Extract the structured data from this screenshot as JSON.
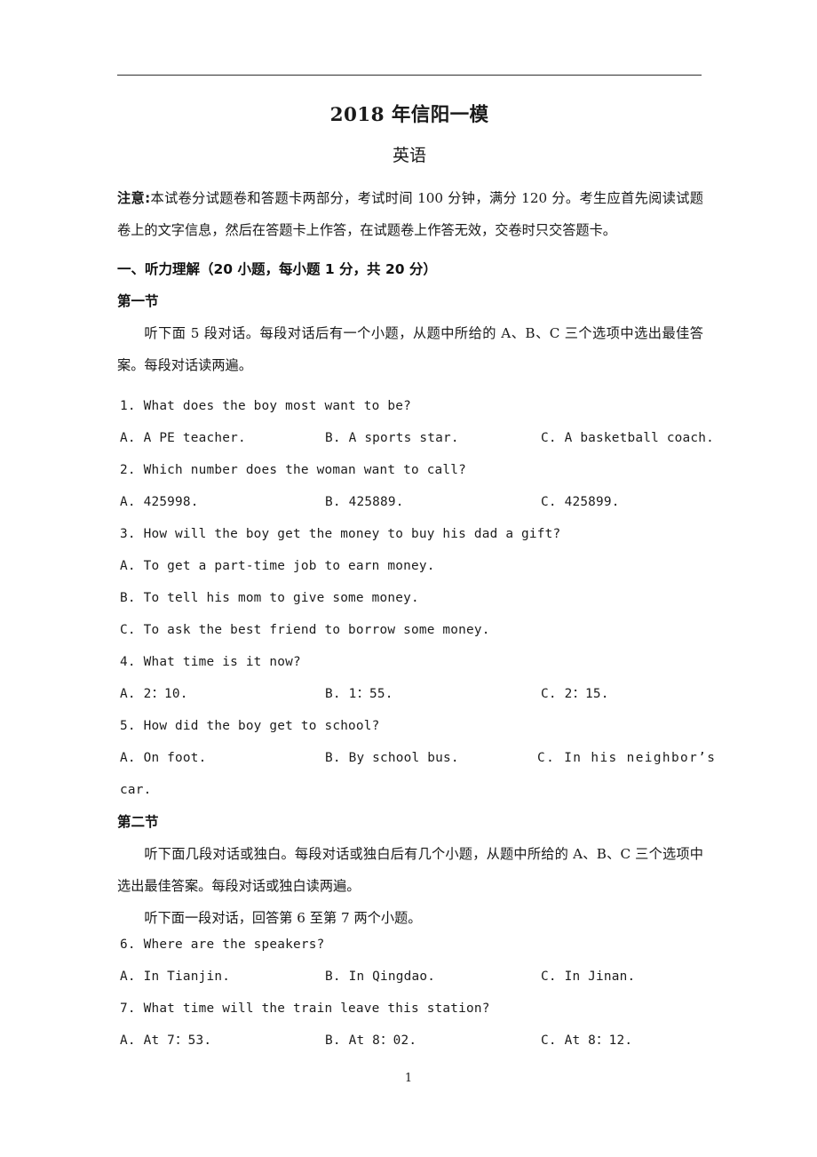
{
  "document": {
    "title": "2018 年信阳一模",
    "subtitle": "英语",
    "page_number": "1"
  },
  "notice": {
    "label": "注意:",
    "text": "本试卷分试题卷和答题卡两部分，考试时间 100 分钟，满分 120 分。考生应首先阅读试题卷上的文字信息，然后在答题卡上作答，在试题卷上作答无效，交卷时只交答题卡。"
  },
  "part_one": {
    "heading": "一、听力理解（20 小题，每小题 1 分，共 20 分）",
    "section_one": {
      "heading": "第一节",
      "instruction": "听下面 5 段对话。每段对话后有一个小题，从题中所给的 A、B、C 三个选项中选出最佳答案。每段对话读两遍。"
    },
    "section_two": {
      "heading": "第二节",
      "instruction": "听下面几段对话或独白。每段对话或独白后有几个小题，从题中所给的 A、B、C 三个选项中选出最佳答案。每段对话或独白读两遍。",
      "sub_instruction": "听下面一段对话，回答第 6 至第 7 两个小题。"
    }
  },
  "questions": [
    {
      "number": "1.",
      "stem": "1. What does the boy most want to be?",
      "layout": "row",
      "options": [
        "A. A PE teacher.",
        "B. A sports star.",
        "C. A basketball coach."
      ]
    },
    {
      "number": "2.",
      "stem": "2. Which number does the woman want to call?",
      "layout": "row",
      "options": [
        "A. 425998.",
        "B. 425889.",
        "C. 425899."
      ]
    },
    {
      "number": "3.",
      "stem": "3. How will the boy get the money to buy his dad a gift?",
      "layout": "stacked",
      "options": [
        "A. To get a part-time job to earn money.",
        "B. To tell his mom to give some money.",
        "C. To ask the best friend to borrow some money."
      ]
    },
    {
      "number": "4.",
      "stem": "4. What time is it now?",
      "layout": "row",
      "options": [
        "A. 2：10.",
        "B. 1：55.",
        "C. 2：15."
      ]
    },
    {
      "number": "5.",
      "stem": "5. How did the boy get to school?",
      "layout": "row-wrapped",
      "options": [
        "A. On foot.",
        "B. By school bus.",
        "C. In his neighbor’s"
      ],
      "wrapped_tail": "car."
    },
    {
      "number": "6.",
      "stem": "6. Where are the speakers?",
      "layout": "row",
      "options": [
        "A. In Tianjin.",
        "B. In Qingdao.",
        "C. In Jinan."
      ]
    },
    {
      "number": "7.",
      "stem": "7. What time will the train leave this station?",
      "layout": "row",
      "options": [
        "A. At 7：53.",
        "B. At 8：02.",
        "C. At 8：12."
      ]
    }
  ]
}
